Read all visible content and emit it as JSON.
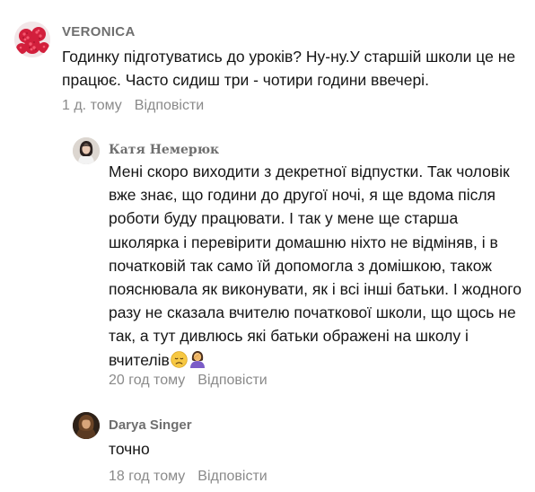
{
  "comments": [
    {
      "author": "VERONICA",
      "avatar_icon": "raspberries-avatar",
      "text": "Годинку підготуватись до уроків? Ну-ну.У старшій школи це не працює. Часто сидиш три - чотири години ввечері.",
      "time": "1 д. тому",
      "reply_label": "Відповісти"
    },
    {
      "author": "Катя Немерюк",
      "avatar_icon": "person-photo-avatar",
      "text": "Мені скоро виходити з декретної відпустки. Так чоловік вже знає, що години до другої ночі, я ще вдома після роботи буду працювати. І так у мене ще старша школярка і перевірити домашню ніхто не відміняв, і в початковій так само їй допомогла з домішкою, також пояснювала як виконувати, як і всі інші батьки. І жодного разу не сказала вчителю початкової школи, що щось не так, а тут дивлюсь які батьки ображені на школу і вчителів",
      "emojis": [
        "disappointed-face-emoji",
        "woman-facepalming-emoji"
      ],
      "time": "20 год тому",
      "reply_label": "Відповісти"
    },
    {
      "author": "Darya Singer",
      "avatar_icon": "person-photo-avatar",
      "text": "точно",
      "time": "18 год тому",
      "reply_label": "Відповісти"
    }
  ],
  "colors": {
    "author": "#6f6f6f",
    "meta": "#8a8a8a",
    "text": "#151515"
  }
}
